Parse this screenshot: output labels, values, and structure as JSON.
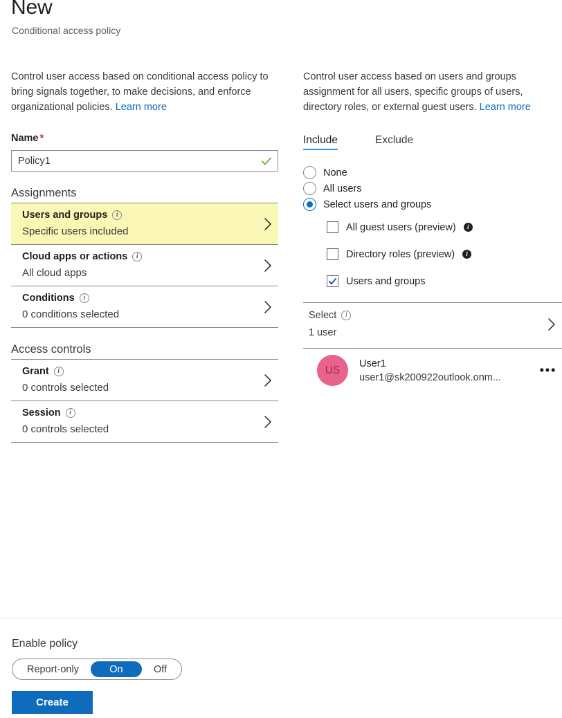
{
  "header": {
    "title": "New",
    "subtitle": "Conditional access policy"
  },
  "left": {
    "intro": "Control user access based on conditional access policy to bring signals together, to make decisions, and enforce organizational policies.",
    "intro_link": "Learn more",
    "name_label": "Name",
    "name_required": "*",
    "name_value": "Policy1",
    "name_placeholder": "",
    "assignments_heading": "Assignments",
    "access_controls_heading": "Access controls",
    "rows": [
      {
        "title": "Users and groups",
        "sub": "Specific users included",
        "highlighted": true
      },
      {
        "title": "Cloud apps or actions",
        "sub": "All cloud apps",
        "highlighted": false
      },
      {
        "title": "Conditions",
        "sub": "0 conditions selected",
        "highlighted": false
      }
    ],
    "control_rows": [
      {
        "title": "Grant",
        "sub": "0 controls selected"
      },
      {
        "title": "Session",
        "sub": "0 controls selected"
      }
    ]
  },
  "right": {
    "intro": "Control user access based on users and groups assignment for all users, specific groups of users, directory roles, or external guest users.",
    "intro_link": "Learn more",
    "tabs": [
      {
        "label": "Include",
        "active": true
      },
      {
        "label": "Exclude",
        "active": false
      }
    ],
    "radios": [
      {
        "label": "None",
        "selected": false
      },
      {
        "label": "All users",
        "selected": false
      },
      {
        "label": "Select users and groups",
        "selected": true
      }
    ],
    "checkboxes": [
      {
        "label": "All guest users (preview)",
        "checked": false,
        "info": true
      },
      {
        "label": "Directory roles (preview)",
        "checked": false,
        "info": true
      },
      {
        "label": "Users and groups",
        "checked": true,
        "info": false
      }
    ],
    "select_row": {
      "title": "Select",
      "sub": "1 user"
    },
    "user": {
      "initials": "US",
      "name": "User1",
      "email": "user1@sk200922outlook.onm...",
      "overflow": "•••"
    }
  },
  "footer": {
    "enable_label": "Enable policy",
    "segments": [
      {
        "label": "Report-only",
        "active": false
      },
      {
        "label": "On",
        "active": true
      },
      {
        "label": "Off",
        "active": false
      }
    ],
    "create_label": "Create"
  },
  "colors": {
    "accent": "#0f6cbd",
    "highlight": "#fbf7b5",
    "avatar": "#e8628c",
    "tab_underline": "#2899f5",
    "checkbox_border": "#7a5c88",
    "input_border": "#9a7aa0",
    "valid_check": "#5a9e3a"
  }
}
